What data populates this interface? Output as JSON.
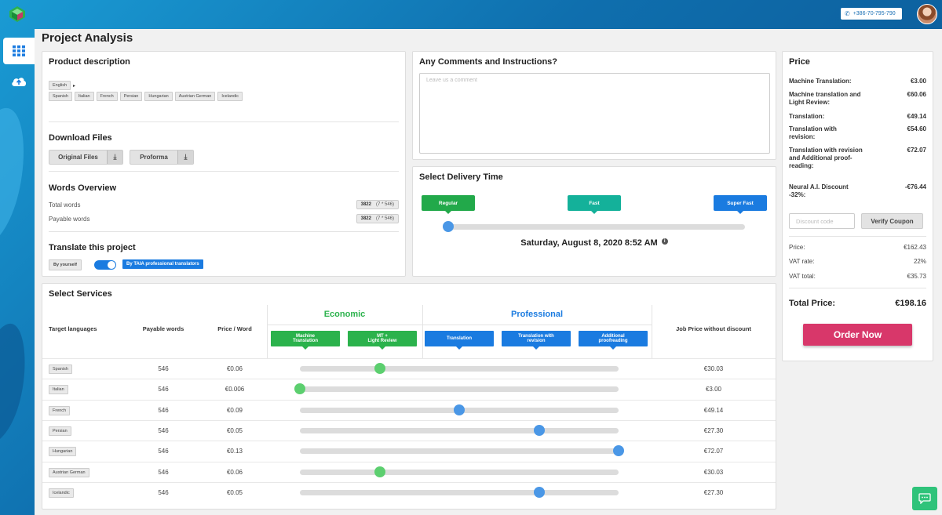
{
  "header": {
    "phone": "+386-70-795-790"
  },
  "page_title": "Project Analysis",
  "product": {
    "title": "Product description",
    "source_language": "English",
    "target_languages": [
      "Spanish",
      "Italian",
      "French",
      "Persian",
      "Hungarian",
      "Austrian German",
      "Icelandic"
    ],
    "download_title": "Download Files",
    "original_files": "Original Files",
    "proforma": "Proforma",
    "words_title": "Words Overview",
    "total_words_label": "Total words",
    "total_words_value": "3822",
    "total_words_detail": "(7 * 546)",
    "payable_words_label": "Payable words",
    "payable_words_value": "3822",
    "payable_words_detail": "(7 * 546)",
    "translate_title": "Translate this project",
    "by_yourself": "By yourself",
    "by_taia": "By TAIA professional translators"
  },
  "comments": {
    "title": "Any Comments and Instructions?",
    "placeholder": "Leave us a comment"
  },
  "delivery": {
    "title": "Select Delivery Time",
    "options": [
      "Regular",
      "Fast",
      "Super Fast"
    ],
    "slider_value": 0,
    "date": "Saturday, August 8, 2020 8:52 AM",
    "colors": {
      "regular": "#22a94a",
      "fast": "#14b19a",
      "super_fast": "#1a7be0"
    }
  },
  "price": {
    "title": "Price",
    "items": [
      {
        "label": "Machine Translation:",
        "value": "€3.00"
      },
      {
        "label": "Machine translation and Light Review:",
        "value": "€60.06"
      },
      {
        "label": "Translation:",
        "value": "€49.14"
      },
      {
        "label": "Translation with revision:",
        "value": "€54.60"
      },
      {
        "label": "Translation with revision and Additional proof-reading:",
        "value": "€72.07"
      },
      {
        "label": "Neural A.I. Discount -32%:",
        "value": "-€76.44"
      }
    ],
    "discount_placeholder": "Discount code",
    "verify": "Verify Coupon",
    "price_label": "Price:",
    "price_value": "€162.43",
    "vat_rate_label": "VAT rate:",
    "vat_rate_value": "22%",
    "vat_total_label": "VAT total:",
    "vat_total_value": "€35.73",
    "total_label": "Total Price:",
    "total_value": "€198.16",
    "order": "Order Now"
  },
  "services": {
    "title": "Select Services",
    "col_target": "Target languages",
    "col_payable": "Payable words",
    "col_price_word": "Price / Word",
    "col_job_price": "Job Price without discount",
    "economic": "Economic",
    "professional": "Professional",
    "levels": [
      {
        "line1": "Machine",
        "line2": "Translation",
        "color": "#2bb24c"
      },
      {
        "line1": "MT +",
        "line2": "Light Review",
        "color": "#2bb24c"
      },
      {
        "line1": "Translation",
        "line2": "",
        "color": "#1a7be0"
      },
      {
        "line1": "Translation with",
        "line2": "revision",
        "color": "#1a7be0"
      },
      {
        "line1": "Additional",
        "line2": "proofreading",
        "color": "#1a7be0"
      }
    ],
    "rows": [
      {
        "lang": "Spanish",
        "words": "546",
        "price_word": "€0.06",
        "level": 1,
        "job_price": "€30.03"
      },
      {
        "lang": "Italian",
        "words": "546",
        "price_word": "€0.006",
        "level": 0,
        "job_price": "€3.00"
      },
      {
        "lang": "French",
        "words": "546",
        "price_word": "€0.09",
        "level": 2,
        "job_price": "€49.14"
      },
      {
        "lang": "Persian",
        "words": "546",
        "price_word": "€0.05",
        "level": 3,
        "job_price": "€27.30"
      },
      {
        "lang": "Hungarian",
        "words": "546",
        "price_word": "€0.13",
        "level": 4,
        "job_price": "€72.07"
      },
      {
        "lang": "Austrian German",
        "words": "546",
        "price_word": "€0.06",
        "level": 1,
        "job_price": "€30.03"
      },
      {
        "lang": "Icelandic",
        "words": "546",
        "price_word": "€0.05",
        "level": 3,
        "job_price": "€27.30"
      }
    ]
  }
}
